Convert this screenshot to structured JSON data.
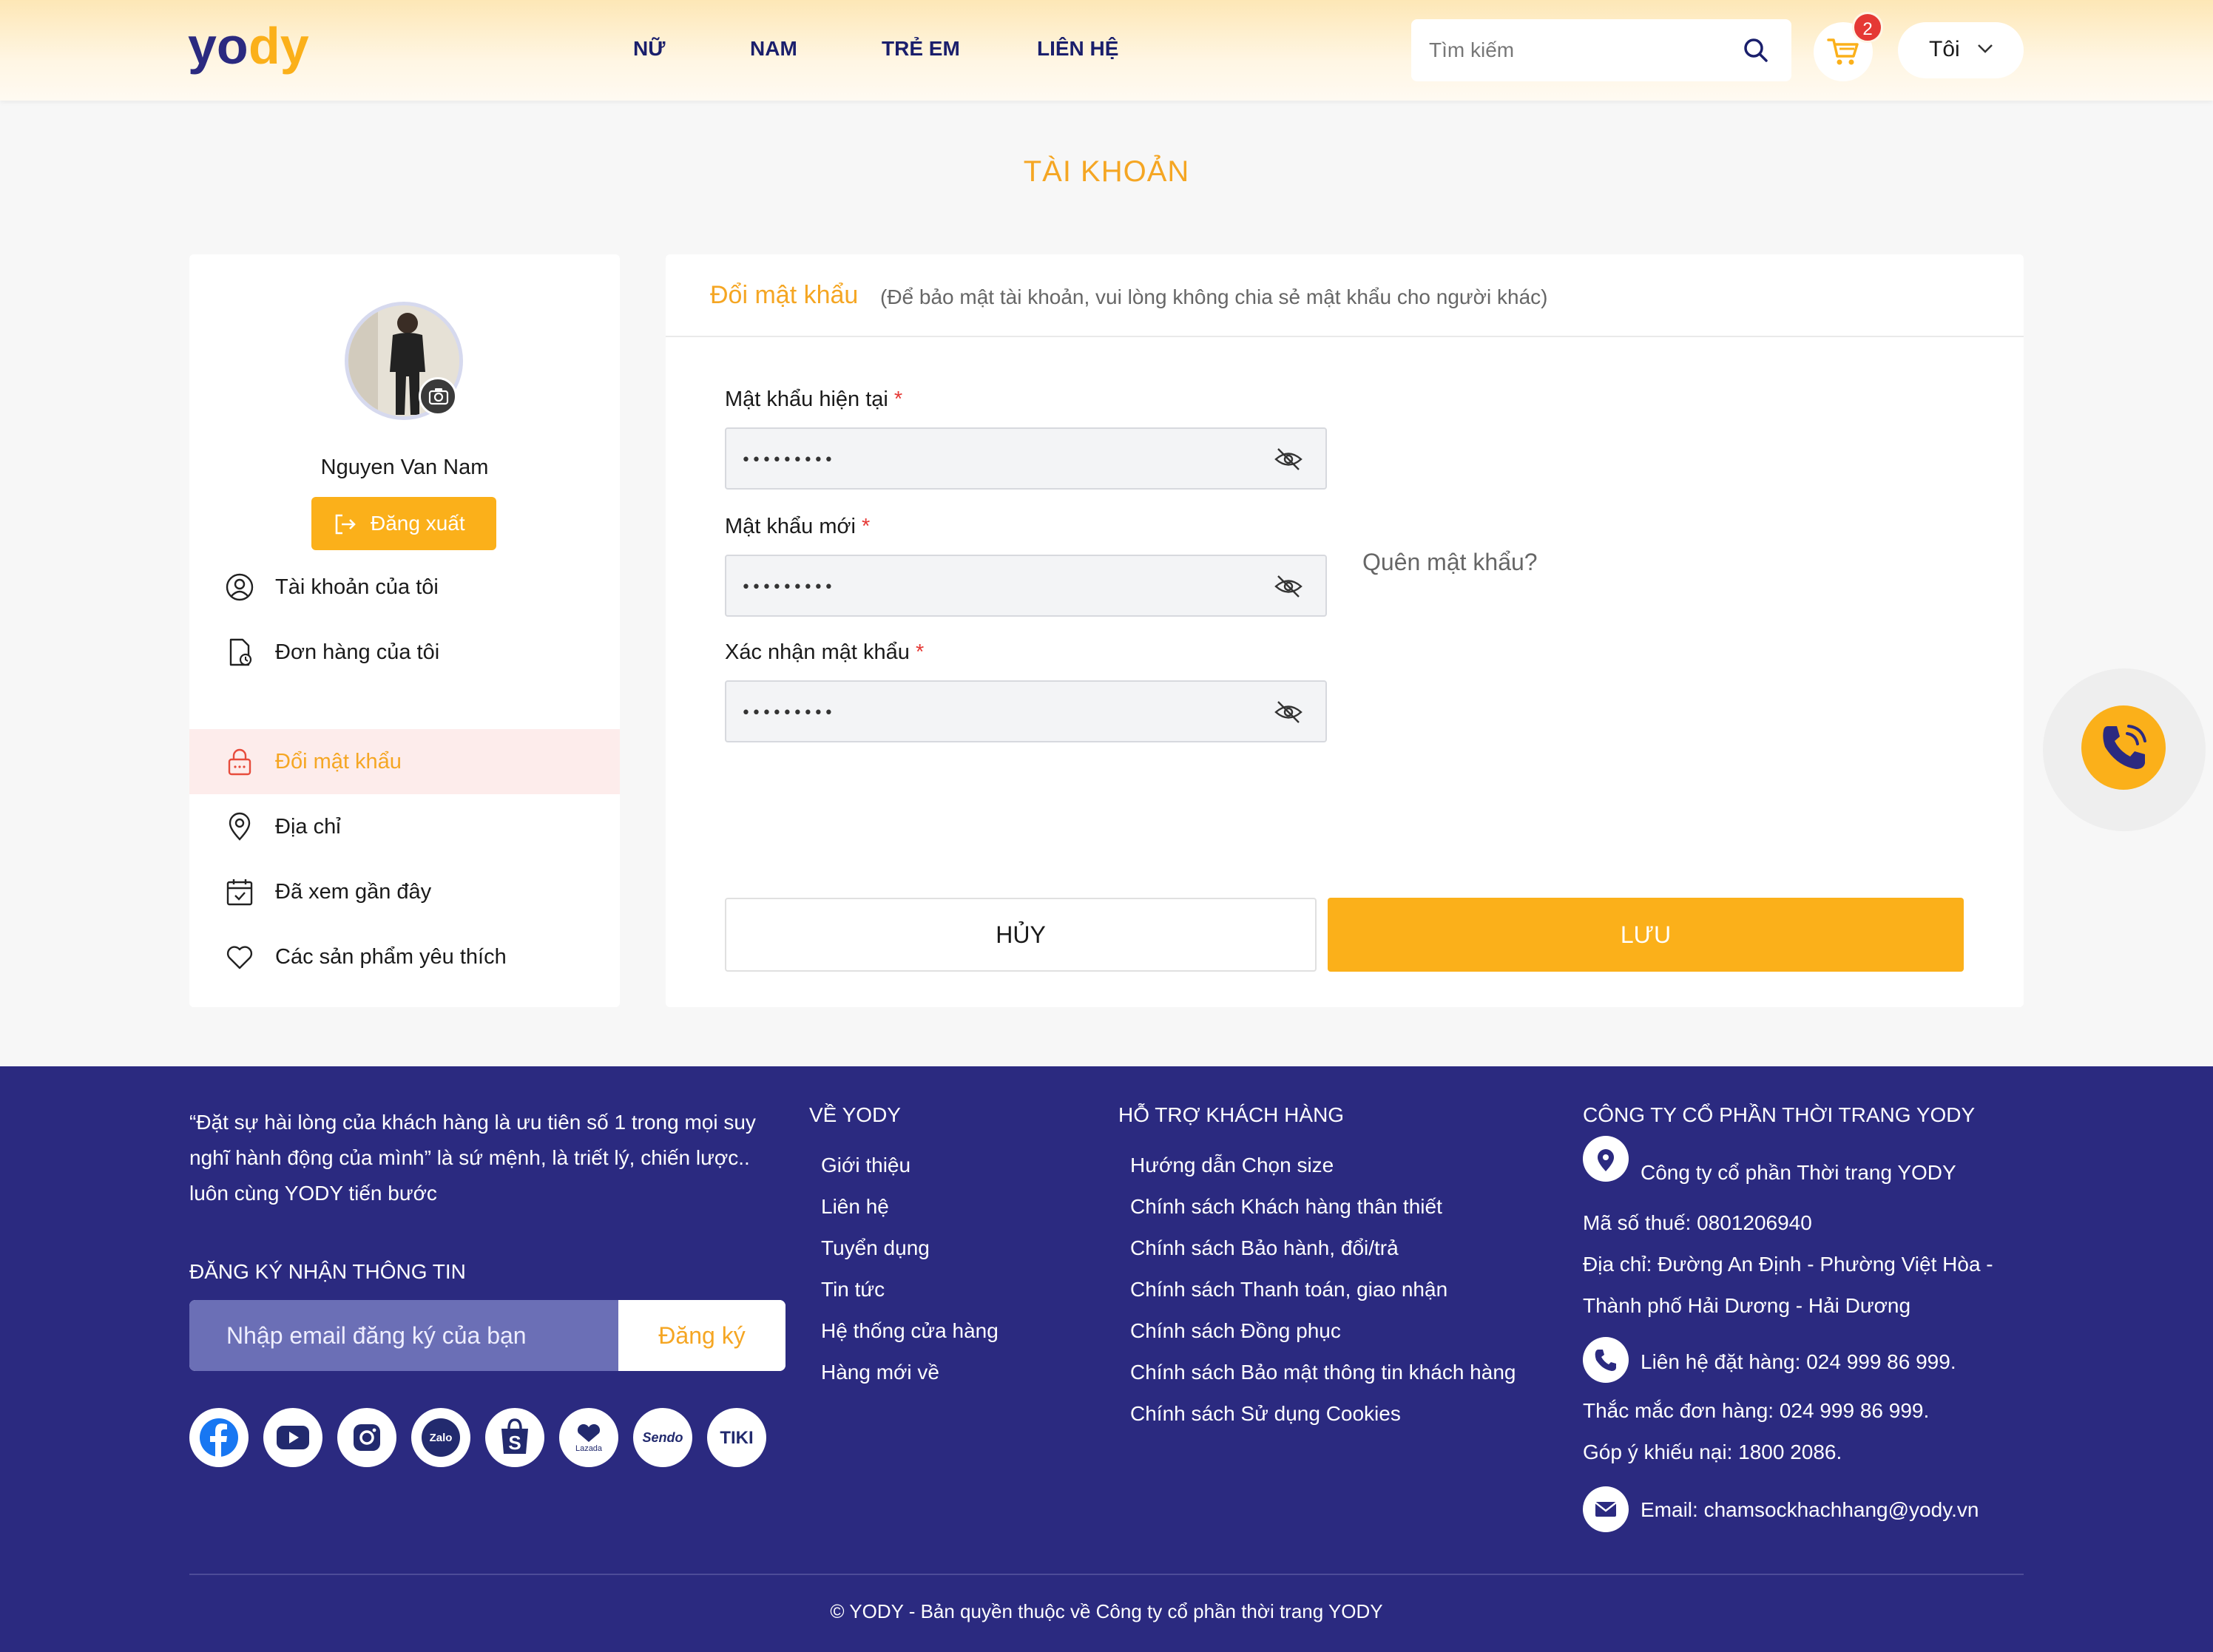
{
  "brand": {
    "logo_text": "yody",
    "accent": "#fbb01a",
    "primary": "#2b2a80"
  },
  "header": {
    "nav": [
      {
        "label": "NỮ"
      },
      {
        "label": "NAM"
      },
      {
        "label": "TRẺ EM"
      },
      {
        "label": "LIÊN HỆ"
      }
    ],
    "search_placeholder": "Tìm kiếm",
    "cart_count": "2",
    "user_label": "Tôi"
  },
  "page_title": "TÀI KHOẢN",
  "sidebar": {
    "username": "Nguyen Van Nam",
    "logout_label": "Đăng xuất",
    "items": [
      {
        "label": "Tài khoản của tôi",
        "icon": "user-circle-icon"
      },
      {
        "label": "Đơn hàng của tôi",
        "icon": "order-document-icon"
      },
      {
        "label": "Đổi mật khẩu",
        "icon": "lock-icon",
        "active": true
      },
      {
        "label": "Địa chỉ",
        "icon": "location-pin-icon"
      },
      {
        "label": "Đã xem gần đây",
        "icon": "calendar-check-icon"
      },
      {
        "label": "Các sản phẩm yêu thích",
        "icon": "heart-icon"
      }
    ]
  },
  "form": {
    "title": "Đổi mật khẩu",
    "note": "(Để bảo mật tài khoản, vui lòng không chia sẻ mật khẩu cho người khác)",
    "fields": [
      {
        "label": "Mật khẩu hiện tại",
        "required": "*",
        "value": "•••••••••"
      },
      {
        "label": "Mật khẩu mới",
        "required": "*",
        "value": "•••••••••"
      },
      {
        "label": "Xác nhận mật khẩu",
        "required": "*",
        "value": "•••••••••"
      }
    ],
    "forgot_label": "Quên mật khẩu?",
    "cancel_label": "HỦY",
    "save_label": "LƯU"
  },
  "footer": {
    "quote": "“Đặt sự hài lòng của khách hàng là ưu tiên số 1 trong mọi suy nghĩ hành động của mình” là sứ mệnh, là triết lý, chiến lược.. luôn cùng YODY tiến bước",
    "subscribe_title": "ĐĂNG KÝ NHẬN THÔNG TIN",
    "subscribe_placeholder": "Nhập email đăng ký của bạn",
    "subscribe_button": "Đăng ký",
    "social": [
      "facebook-icon",
      "youtube-icon",
      "instagram-icon",
      "zalo-icon",
      "shopee-icon",
      "lazada-icon",
      "sendo-icon",
      "tiki-icon"
    ],
    "social_text": {
      "zalo": "Zalo",
      "lazada": "Lazada",
      "sendo": "Sendo",
      "tiki": "TIKI"
    },
    "about_title": "VỀ YODY",
    "about_links": [
      "Giới thiệu",
      "Liên hệ",
      "Tuyển dụng",
      "Tin tức",
      "Hệ thống cửa hàng",
      "Hàng mới về"
    ],
    "support_title": "HỖ TRỢ KHÁCH HÀNG",
    "support_links": [
      "Hướng dẫn Chọn size",
      "Chính sách Khách hàng thân thiết",
      "Chính sách Bảo hành, đổi/trả",
      "Chính sách Thanh toán, giao nhận",
      "Chính sách Đồng phục",
      "Chính sách Bảo mật thông tin khách hàng",
      "Chính sách Sử dụng Cookies"
    ],
    "company_title": "CÔNG TY CỔ PHẦN THỜI TRANG YODY",
    "company_name": "Công ty cổ phần Thời trang YODY",
    "tax": "Mã số thuế: 0801206940",
    "address_1": "Địa chỉ: Đường An Định - Phường Việt Hòa -",
    "address_2": "Thành phố Hải Dương - Hải Dương",
    "hotline": "Liên hệ đặt hàng: 024 999 86 999.",
    "order_question": "Thắc mắc đơn hàng: 024 999 86 999.",
    "complaint": "Góp ý khiếu nại: 1800 2086.",
    "email": "Email: chamsockhachhang@yody.vn",
    "copyright": "© YODY - Bản quyền thuộc về Công ty cổ phần thời trang YODY"
  }
}
